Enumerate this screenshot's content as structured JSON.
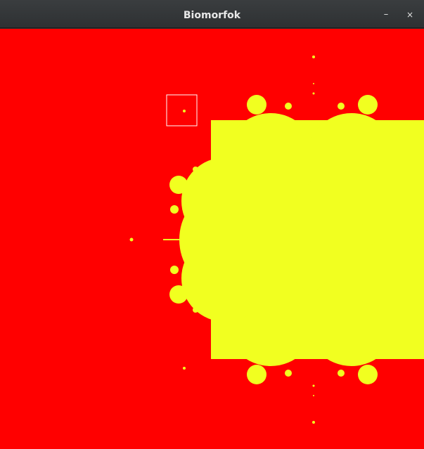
{
  "window": {
    "title": "Biomorfok",
    "minimize_glyph": "–",
    "close_glyph": "×"
  },
  "fractal": {
    "background_color": "#ff0000",
    "set_color": "#f1ff20",
    "selection_color": "#ffffff"
  }
}
